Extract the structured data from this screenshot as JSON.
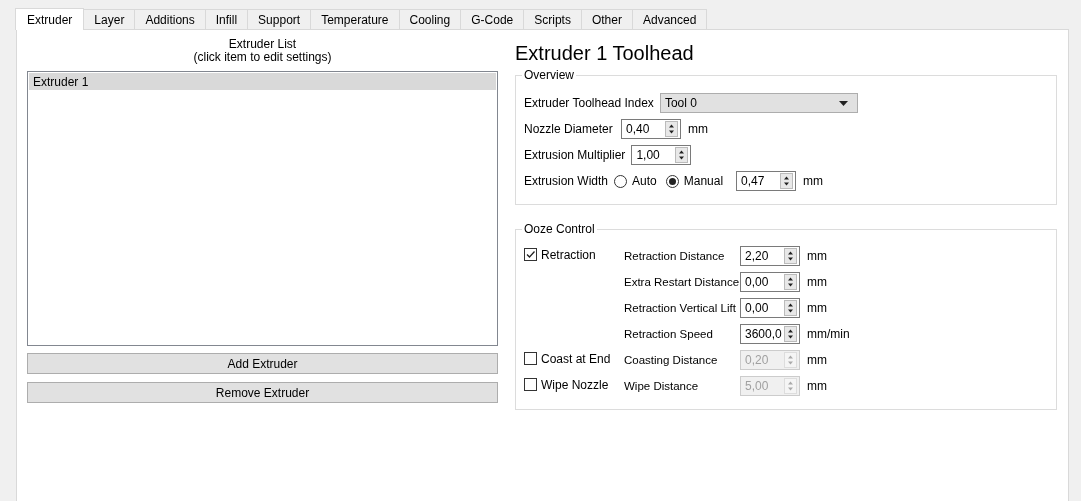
{
  "tabs": [
    {
      "label": "Extruder",
      "selected": true
    },
    {
      "label": "Layer",
      "selected": false
    },
    {
      "label": "Additions",
      "selected": false
    },
    {
      "label": "Infill",
      "selected": false
    },
    {
      "label": "Support",
      "selected": false
    },
    {
      "label": "Temperature",
      "selected": false
    },
    {
      "label": "Cooling",
      "selected": false
    },
    {
      "label": "G-Code",
      "selected": false
    },
    {
      "label": "Scripts",
      "selected": false
    },
    {
      "label": "Other",
      "selected": false
    },
    {
      "label": "Advanced",
      "selected": false
    }
  ],
  "extruder_list": {
    "title": "Extruder List",
    "hint": "(click item to edit settings)",
    "items": [
      {
        "label": "Extruder 1",
        "selected": true
      }
    ],
    "buttons": [
      "Add Extruder",
      "Remove Extruder"
    ]
  },
  "toolhead": {
    "title": "Extruder 1 Toolhead",
    "overview": {
      "title": "Overview",
      "rows": [
        {
          "kind": "dropdown",
          "label": "Extruder Toolhead Index",
          "value": "Tool 0"
        },
        {
          "kind": "spin",
          "label": "Nozzle Diameter",
          "value": "0,40",
          "unit": "mm"
        },
        {
          "kind": "spin",
          "label": "Extrusion Multiplier",
          "value": "1,00"
        },
        {
          "kind": "radio",
          "label": "Extrusion Width",
          "options": [
            {
              "label": "Auto",
              "selected": false
            },
            {
              "label": "Manual",
              "selected": true
            }
          ],
          "value": "0,47",
          "unit": "mm"
        }
      ]
    },
    "ooze_control": {
      "title": "Ooze Control",
      "options": [
        {
          "label": "Retraction",
          "checked": true,
          "fields": [
            {
              "label": "Retraction Distance",
              "value": "2,20",
              "unit": "mm",
              "disabled": false
            },
            {
              "label": "Extra Restart Distance",
              "value": "0,00",
              "unit": "mm",
              "disabled": false
            },
            {
              "label": "Retraction Vertical Lift",
              "value": "0,00",
              "unit": "mm",
              "disabled": false
            },
            {
              "label": "Retraction Speed",
              "value": "3600,0",
              "unit": "mm/min",
              "disabled": false
            }
          ]
        },
        {
          "label": "Coast at End",
          "checked": false,
          "fields": [
            {
              "label": "Coasting Distance",
              "value": "0,20",
              "unit": "mm",
              "disabled": true
            }
          ]
        },
        {
          "label": "Wipe Nozzle",
          "checked": false,
          "fields": [
            {
              "label": "Wipe Distance",
              "value": "5,00",
              "unit": "mm",
              "disabled": true
            }
          ]
        }
      ]
    }
  }
}
